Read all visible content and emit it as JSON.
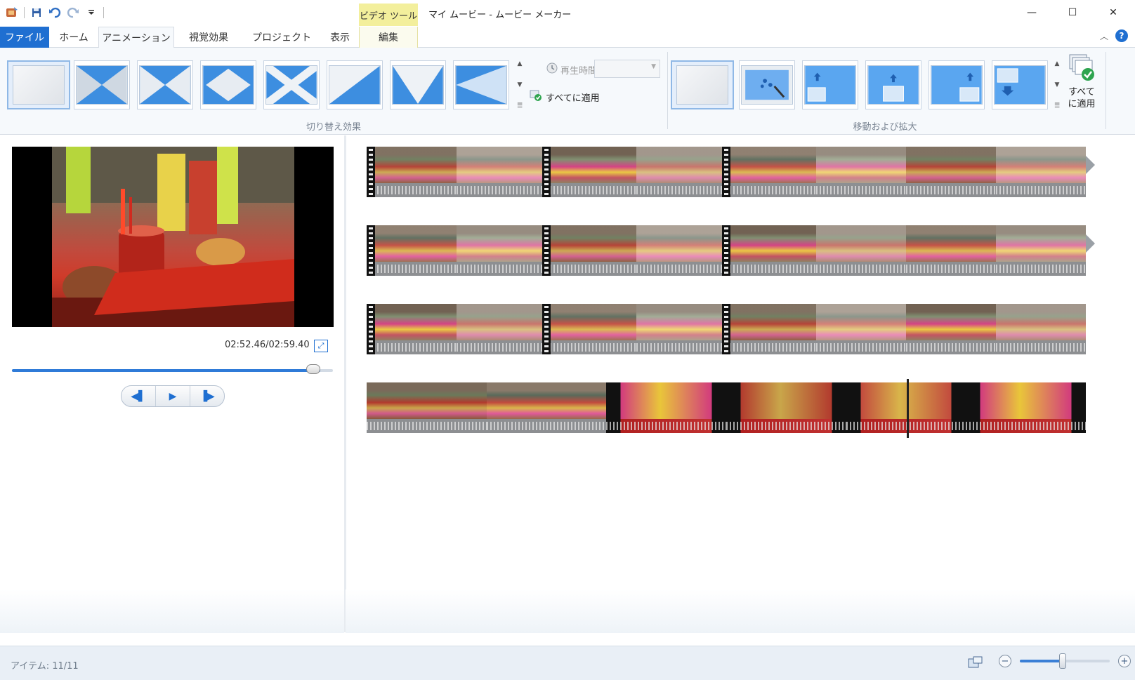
{
  "window": {
    "title": "マイ ムービー - ムービー メーカー",
    "context_tool_label": "ビデオ ツール",
    "controls": {
      "minimize": "—",
      "maximize": "☐",
      "close": "✕"
    }
  },
  "quick_access": {
    "icons": [
      "app-icon",
      "save-icon",
      "undo-icon",
      "redo-icon",
      "customize-dropdown-icon"
    ]
  },
  "tabs": [
    {
      "label": "ファイル"
    },
    {
      "label": "ホーム"
    },
    {
      "label": "アニメーション"
    },
    {
      "label": "視覚効果"
    },
    {
      "label": "プロジェクト"
    },
    {
      "label": "表示"
    },
    {
      "label": "編集"
    }
  ],
  "active_tab": "アニメーション",
  "ribbon": {
    "transitions_group": {
      "label": "切り替え効果",
      "duration_label": "再生時間:",
      "duration_value": "",
      "apply_all_label": "すべてに適用",
      "items": [
        "none",
        "cross-diagonal",
        "bowtie-horizontal",
        "diamond",
        "x-cross",
        "diagonal-wipe",
        "v-shape",
        "arrow-left"
      ],
      "selected_index": 0
    },
    "pan_zoom_group": {
      "label": "移動および拡大",
      "apply_all_label_line1": "すべて",
      "apply_all_label_line2": "に適用",
      "items": [
        "none",
        "auto",
        "zoom-in-top",
        "zoom-in-center",
        "zoom-in-right",
        "pan-down"
      ],
      "selected_index": 0
    }
  },
  "preview": {
    "time_readout": "02:52.46/02:59.40",
    "progress": 0.96,
    "transport": {
      "previous_frame": "◀▌",
      "play": "▶",
      "next_frame": "▐▶"
    }
  },
  "storyboard": {
    "rows": [
      {
        "clip_count": 8
      },
      {
        "clip_count": 8
      },
      {
        "clip_count": 8
      },
      {
        "clip_count": 6
      }
    ],
    "selected_clip": "last"
  },
  "statusbar": {
    "items_text": "アイテム: 11/11",
    "zoom_level": 0.48
  },
  "colors": {
    "accent": "#1f6fd1",
    "context_tab": "#f3ef9c",
    "selection": "#6eb7e6"
  }
}
